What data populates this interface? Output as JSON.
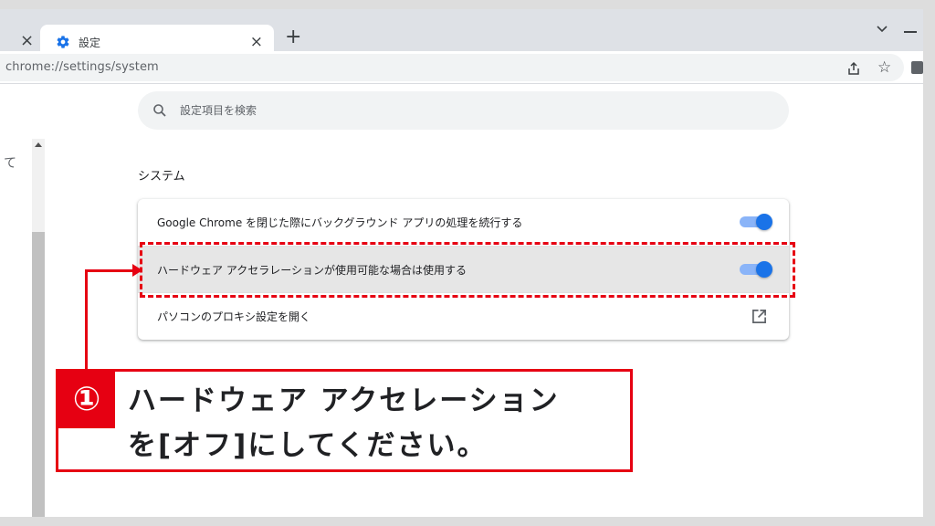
{
  "browser": {
    "tab": {
      "title": "設定",
      "close_glyph": "×",
      "icon": "gear-icon"
    },
    "prev_tab_close_glyph": "×",
    "new_tab_glyph": "+",
    "omnibox": {
      "url": "chrome://settings/system"
    },
    "icons": [
      "tab-search-icon",
      "share-icon",
      "star-icon",
      "extension-icon"
    ]
  },
  "sidebar": {
    "fragment": "て"
  },
  "search": {
    "placeholder": "設定項目を検索"
  },
  "section": {
    "title": "システム",
    "items": [
      {
        "label": "Google Chrome を閉じた際にバックグラウンド アプリの処理を続行する",
        "type": "toggle",
        "state": "on"
      },
      {
        "label": "ハードウェア アクセラレーションが使用可能な場合は使用する",
        "type": "toggle",
        "state": "on"
      },
      {
        "label": "パソコンのプロキシ設定を開く",
        "type": "link",
        "icon": "external-link-icon"
      }
    ]
  },
  "annotation": {
    "step": "①",
    "line1": "ハードウェア アクセレーション",
    "line2": "を[オフ]にしてください。"
  },
  "colors": {
    "accent": "#1a73e8",
    "toggle_track": "#8ab4f8",
    "highlight_red": "#e60012",
    "tabstrip": "#dee1e6",
    "omnibox": "#f1f3f4"
  }
}
